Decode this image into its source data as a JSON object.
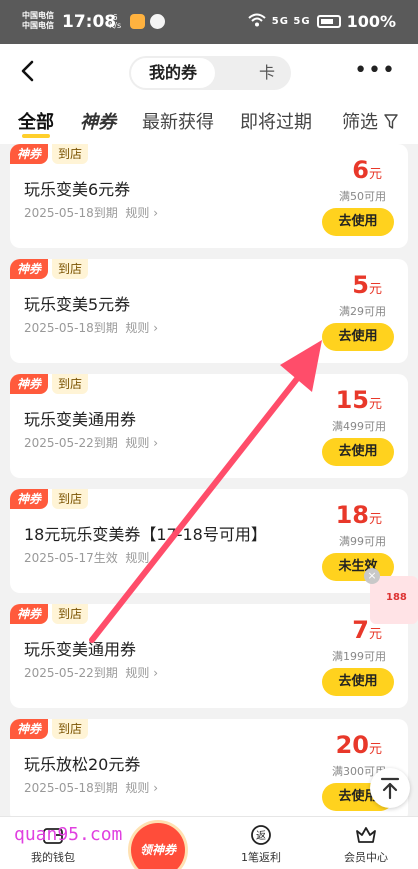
{
  "status_bar": {
    "carrier_line1": "中国电信",
    "carrier_line2": "中国电信",
    "time": "17:08",
    "speed_value": "6",
    "speed_unit": "K/s",
    "network": "5G 5G",
    "battery": "100%"
  },
  "header": {
    "segment_mine": "我的券",
    "segment_card": "卡",
    "more": "•••"
  },
  "tabs": {
    "all": "全部",
    "shen": "神券",
    "newest": "最新获得",
    "expiring": "即将过期",
    "filter": "筛选"
  },
  "badges": {
    "shen": "神券",
    "store": "到店"
  },
  "coupons": [
    {
      "title": "玩乐变美6元券",
      "date": "2025-05-18到期",
      "rule": "规则 ›",
      "amount": "6",
      "unit": "元",
      "condition": "满50可用",
      "button": "去使用"
    },
    {
      "title": "玩乐变美5元券",
      "date": "2025-05-18到期",
      "rule": "规则 ›",
      "amount": "5",
      "unit": "元",
      "condition": "满29可用",
      "button": "去使用"
    },
    {
      "title": "玩乐变美通用券",
      "date": "2025-05-22到期",
      "rule": "规则 ›",
      "amount": "15",
      "unit": "元",
      "condition": "满499可用",
      "button": "去使用"
    },
    {
      "title": "18元玩乐变美券【17-18号可用】",
      "date": "2025-05-17生效",
      "rule": "规则 ›",
      "amount": "18",
      "unit": "元",
      "condition": "满99可用",
      "button": "未生效"
    },
    {
      "title": "玩乐变美通用券",
      "date": "2025-05-22到期",
      "rule": "规则 ›",
      "amount": "7",
      "unit": "元",
      "condition": "满199可用",
      "button": "去使用"
    },
    {
      "title": "玩乐放松20元券",
      "date": "2025-05-18到期",
      "rule": "规则 ›",
      "amount": "20",
      "unit": "元",
      "condition": "满300可用",
      "button": "去使用"
    }
  ],
  "floating": {
    "close": "×",
    "number": "188"
  },
  "bottom_nav": {
    "wallet": "我的钱包",
    "center": "领神券",
    "rebate": "1笔返利",
    "member": "会员中心"
  },
  "watermark": "quan95.com",
  "colors": {
    "accent_yellow": "#ffd21e",
    "price_red": "#e8382a",
    "badge_red": "#ff5a3c",
    "arrow_pink": "#ff4d6a"
  }
}
